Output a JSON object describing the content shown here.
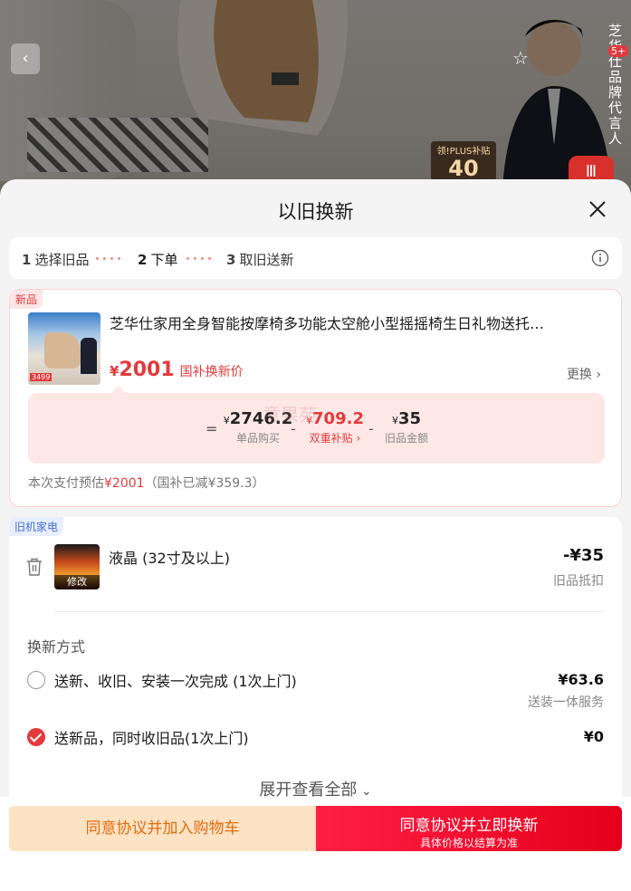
{
  "background": {
    "plus_tag_top": "领!PLUS补贴",
    "plus_tag_value": "40",
    "side_brand_text": "芝华仕品牌代言人",
    "side_badge": "5+"
  },
  "sheet": {
    "title": "以旧换新"
  },
  "steps": [
    {
      "num": "1",
      "label": "选择旧品"
    },
    {
      "num": "2",
      "label": "下单"
    },
    {
      "num": "3",
      "label": "取旧送新"
    }
  ],
  "new_product": {
    "tag": "新品",
    "title": "芝华仕家用全身智能按摩椅多功能太空舱小型摇摇椅生日礼物送托…",
    "price_yen": "¥",
    "price": "2001",
    "price_label": "国补换新价",
    "change_label": "更换",
    "thumb_badge": "3499",
    "calc": {
      "eq": "=",
      "unit_price": "2746.2",
      "unit_label": "单品购买",
      "minus1": "-",
      "subsidy": "709.2",
      "subsidy_label": "双重补贴",
      "minus2": "-",
      "old_amount": "35",
      "old_label": "旧品金额",
      "yen": "¥"
    },
    "pay_estimate_prefix": "本次支付预估",
    "pay_estimate_value": "¥2001",
    "pay_estimate_suffix": "（国补已减¥359.3）"
  },
  "old_device": {
    "tag": "旧机家电",
    "name": "液晶 (32寸及以上)",
    "edit_label": "修改",
    "price": "-¥35",
    "price_label": "旧品抵扣",
    "method_title": "换新方式",
    "options": [
      {
        "label": "送新、收旧、安装一次完成 (1次上门)",
        "price": "¥63.6",
        "sub": "送装一体服务",
        "checked": false
      },
      {
        "label": "送新品，同时收旧品(1次上门)",
        "price": "¥0",
        "sub": "",
        "checked": true
      }
    ]
  },
  "expand_label": "展开查看全部",
  "bottom": {
    "cart_label": "同意协议并加入购物车",
    "buy_label": "同意协议并立即换新",
    "buy_sub": "具体价格以结算为准"
  },
  "watermark": "意果苑",
  "colors": {
    "accent": "#e4393c",
    "cart_bg": "#fde3c4",
    "cart_text": "#e26c10"
  }
}
